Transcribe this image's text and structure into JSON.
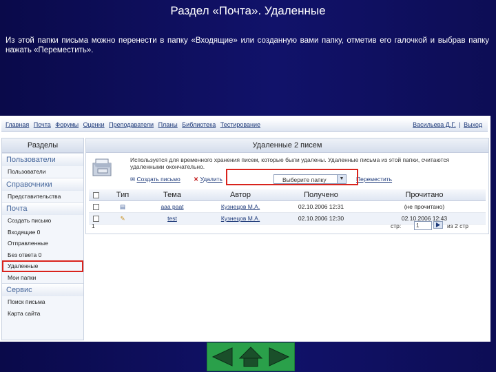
{
  "slide": {
    "title": "Раздел «Почта». Удаленные",
    "description": "Из этой папки письма можно перенести в папку «Входящие» или созданную вами папку, отметив его галочкой и выбрав папку нажать «Переместить»."
  },
  "topnav": {
    "links": [
      "Главная",
      "Почта",
      "Форумы",
      "Оценки",
      "Преподаватели",
      "Планы",
      "Библиотека",
      "Тестирование"
    ],
    "user": "Васильева Д.Г.",
    "separator": "|",
    "logout": "Выход"
  },
  "sidebar": {
    "header": "Разделы",
    "sections": [
      {
        "title": "Пользователи",
        "items": [
          "Пользователи"
        ]
      },
      {
        "title": "Справочники",
        "items": [
          "Представительства"
        ]
      },
      {
        "title": "Почта",
        "items": [
          "Создать письмо",
          "Входящие 0",
          "Отправленные",
          "Без ответа 0",
          "Удаленные",
          "Мои папки"
        ]
      },
      {
        "title": "Сервис",
        "items": [
          "Поиск письма",
          "Карта сайта"
        ]
      }
    ]
  },
  "main": {
    "header": "Удаленные   2 писем",
    "description": "Используется для временного хранения писем, которые были удалены. Удаленные письма из этой папки, считаются удаленными окончательно.",
    "actions": {
      "create": "Создать письмо",
      "delete": "Удалить",
      "folder_select": "Выберите папку",
      "move": "Переместить"
    },
    "table": {
      "headers": [
        "",
        "Тип",
        "Тема",
        "Автор",
        "Получено",
        "Прочитано"
      ],
      "rows": [
        {
          "subject": "aaa paat",
          "author": "Кузнецов М.А.",
          "received": "02.10.2006 12:31",
          "read": "(не прочитано)"
        },
        {
          "subject": "test",
          "author": "Кузнецов М.А.",
          "received": "02.10.2006 12:30",
          "read": "02.10.2006 12:43"
        }
      ]
    },
    "pager": {
      "number": "1",
      "page_label": "стр:",
      "page_value": "1",
      "count": "из 2 стр"
    }
  },
  "colors": {
    "accent": "#d9231c",
    "nav_green": "#2aa04a",
    "link": "#1f3b7a"
  }
}
